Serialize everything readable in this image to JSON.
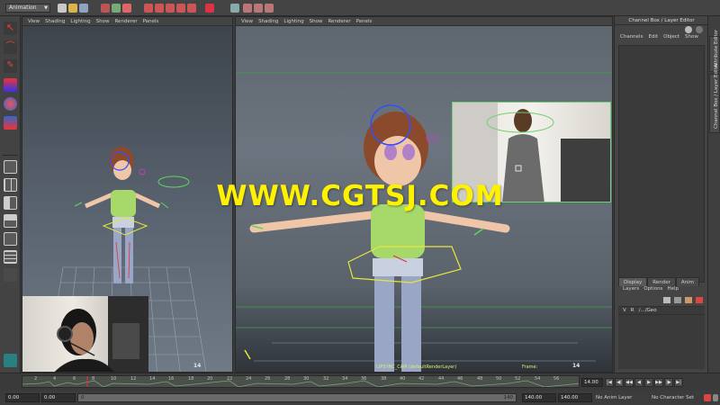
{
  "status_line": {
    "mode": "Animation"
  },
  "left_panel": {
    "menus": [
      "View",
      "Shading",
      "Lighting",
      "Show",
      "Renderer",
      "Panels"
    ],
    "frame": "14"
  },
  "right_panel": {
    "menus": [
      "View",
      "Shading",
      "Lighting",
      "Show",
      "Renderer",
      "Panels"
    ],
    "camera_label": "LIPSYNC_CAM (defaultRenderLayer)",
    "frame_label": "Frame:",
    "frame": "14"
  },
  "watermark": "WWW.CGTSJ.COM",
  "channel_box": {
    "title": "Channel Box / Layer Editor",
    "menus": [
      "Channels",
      "Edit",
      "Object",
      "Show"
    ],
    "layer_tabs": [
      "Display",
      "Render",
      "Anim"
    ],
    "layer_menus": [
      "Layers",
      "Options",
      "Help"
    ],
    "layer_row": {
      "v": "V",
      "r": "R",
      "name": "/.../Geo"
    }
  },
  "side_tabs": [
    "Attribute Editor",
    "Channel Box / Layer Editor"
  ],
  "time_slider": {
    "ticks": [
      "2",
      "4",
      "6",
      "8",
      "10",
      "12",
      "14",
      "16",
      "18",
      "20",
      "22",
      "24",
      "26",
      "28",
      "30",
      "32",
      "34",
      "36",
      "38",
      "40",
      "42",
      "44",
      "46",
      "48",
      "50",
      "52",
      "54",
      "56"
    ],
    "current_frame": "14.00"
  },
  "range_slider": {
    "start": "0.00",
    "inner_start": "0.00",
    "bar_start": "0",
    "bar_end": "140",
    "end": "140.00",
    "outer_end": "140.00",
    "anim_layer": "No Anim Layer",
    "char_set": "No Character Set"
  },
  "colors": {
    "accent_yellow": "#fff200",
    "hud_green": "#d8f06a",
    "control_green": "#5fd65f",
    "control_red": "#e03040",
    "control_blue": "#3050ff"
  },
  "icons": {
    "toolbox": [
      "select-tool-icon",
      "lasso-tool-icon",
      "paint-select-icon",
      "move-tool-icon",
      "rotate-tool-icon",
      "scale-tool-icon",
      "layout-single-icon",
      "layout-four-icon",
      "layout-side-icon",
      "layout-stack-icon",
      "outliner-layout-icon",
      "graph-layout-icon"
    ]
  }
}
